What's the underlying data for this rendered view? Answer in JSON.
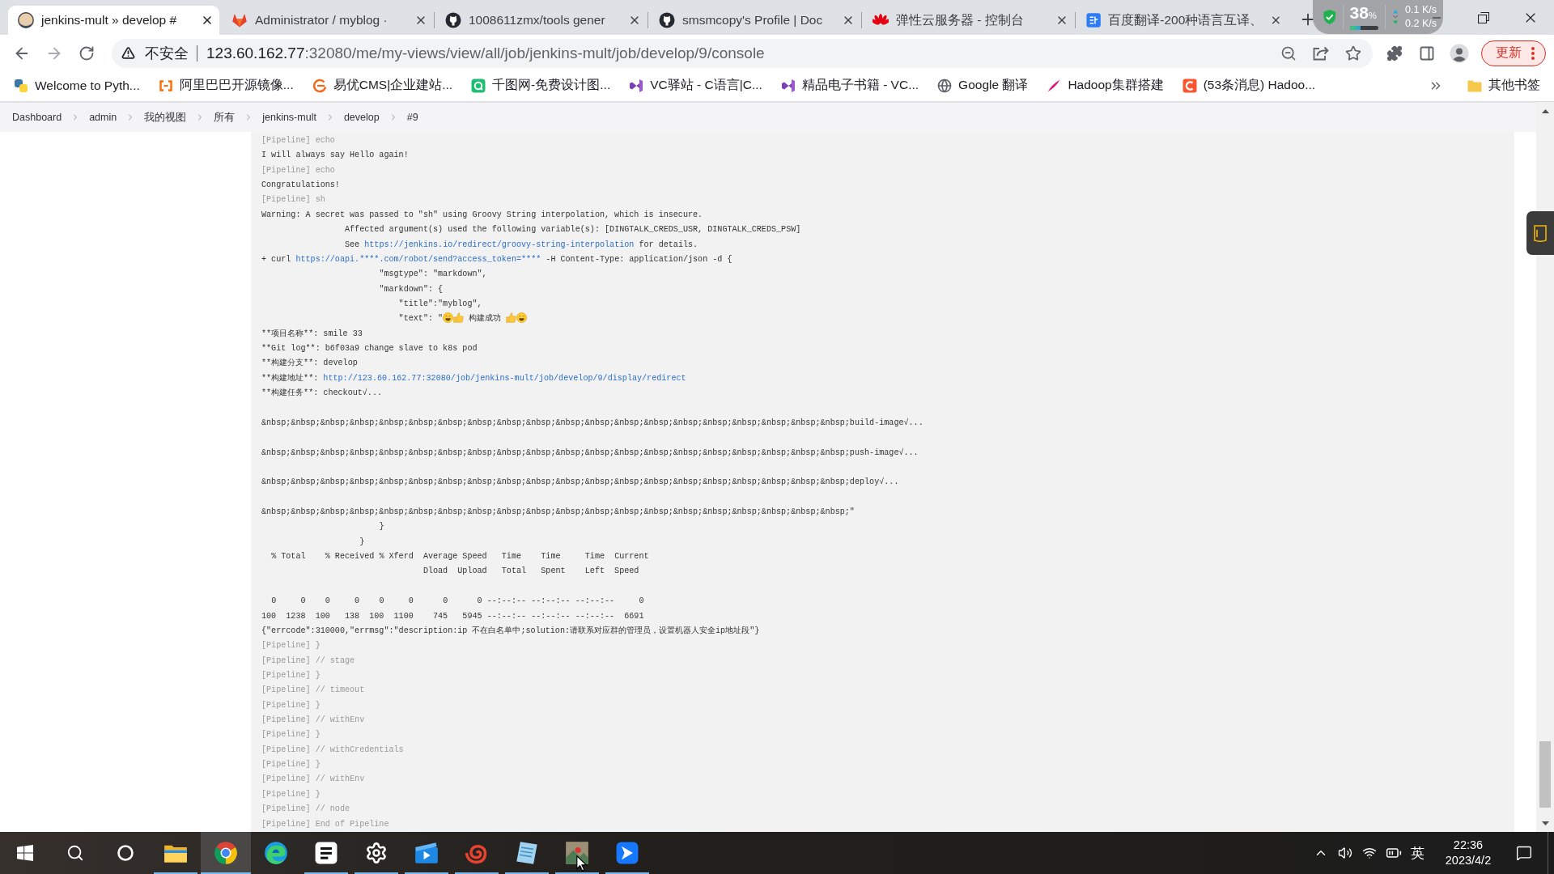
{
  "tabs": [
    {
      "title": "jenkins-mult » develop #",
      "selected": true
    },
    {
      "title": "Administrator / myblog ·",
      "selected": false
    },
    {
      "title": "1008611zmx/tools gener",
      "selected": false
    },
    {
      "title": "smsmcopy's Profile | Doc",
      "selected": false
    },
    {
      "title": "弹性云服务器 - 控制台",
      "selected": false
    },
    {
      "title": "百度翻译-200种语言互译、",
      "selected": false
    }
  ],
  "net_meter": {
    "percent": "38",
    "unit": "%",
    "level": 0.38,
    "upload": "0.1 K/s",
    "download": "0.2 K/s"
  },
  "address_bar": {
    "security": "不安全",
    "host": "123.60.162.77",
    "path": ":32080/me/my-views/view/all/job/jenkins-mult/job/develop/9/console"
  },
  "update_button": "更新",
  "bookmarks": [
    "Welcome to Pyth...",
    "阿里巴巴开源镜像...",
    "易优CMS|企业建站...",
    "千图网-免费设计图...",
    "VC驿站 - C语言|C...",
    "精品电子书籍 - VC...",
    "Google 翻译",
    "Hadoop集群搭建",
    "(53条消息) Hadoo..."
  ],
  "other_bookmarks": "其他书签",
  "breadcrumb": [
    "Dashboard",
    "admin",
    "我的视图",
    "所有",
    "jenkins-mult",
    "develop",
    "#9"
  ],
  "console": {
    "lines": [
      {
        "kind": "step",
        "text": "[Pipeline] echo"
      },
      {
        "kind": "output",
        "text": "I will always say Hello again!"
      },
      {
        "kind": "step",
        "text": "[Pipeline] echo"
      },
      {
        "kind": "output",
        "text": "Congratulations!"
      },
      {
        "kind": "step",
        "text": "[Pipeline] sh"
      },
      {
        "kind": "output",
        "text": "Warning: A secret was passed to \"sh\" using Groovy String interpolation, which is insecure."
      },
      {
        "kind": "output",
        "text": "                 Affected argument(s) used the following variable(s): [DINGTALK_CREDS_USR, DINGTALK_CREDS_PSW]"
      },
      {
        "kind": "link",
        "text": "                 See ",
        "link": "https://jenkins.io/redirect/groovy-string-interpolation",
        "after": " for details."
      },
      {
        "kind": "link",
        "text": "+ curl ",
        "link": "https://oapi.****.com/robot/send?access_token=****",
        "after": " -H Content-Type: application/json -d {"
      },
      {
        "kind": "output",
        "text": "                        \"msgtype\": \"markdown\","
      },
      {
        "kind": "output",
        "text": "                        \"markdown\": {"
      },
      {
        "kind": "output",
        "text": "                            \"title\":\"myblog\","
      },
      {
        "kind": "emoji",
        "text": "                            \"text\": \"",
        "label": "构建成功"
      },
      {
        "kind": "output",
        "text": "**项目名称**: smile 33"
      },
      {
        "kind": "output",
        "text": "**Git log**: b6f03a9 change slave to k8s pod"
      },
      {
        "kind": "output",
        "text": "**构建分支**: develop"
      },
      {
        "kind": "link",
        "text": "**构建地址**: ",
        "link": "http://123.60.162.77:32080/job/jenkins-mult/job/develop/9/display/redirect"
      },
      {
        "kind": "output",
        "text": "**构建任务**: checkout√..."
      },
      {
        "kind": "blank"
      },
      {
        "kind": "output",
        "text": "&nbsp;&nbsp;&nbsp;&nbsp;&nbsp;&nbsp;&nbsp;&nbsp;&nbsp;&nbsp;&nbsp;&nbsp;&nbsp;&nbsp;&nbsp;&nbsp;&nbsp;&nbsp;&nbsp;&nbsp;build-image√..."
      },
      {
        "kind": "blank"
      },
      {
        "kind": "output",
        "text": "&nbsp;&nbsp;&nbsp;&nbsp;&nbsp;&nbsp;&nbsp;&nbsp;&nbsp;&nbsp;&nbsp;&nbsp;&nbsp;&nbsp;&nbsp;&nbsp;&nbsp;&nbsp;&nbsp;&nbsp;push-image√..."
      },
      {
        "kind": "blank"
      },
      {
        "kind": "output",
        "text": "&nbsp;&nbsp;&nbsp;&nbsp;&nbsp;&nbsp;&nbsp;&nbsp;&nbsp;&nbsp;&nbsp;&nbsp;&nbsp;&nbsp;&nbsp;&nbsp;&nbsp;&nbsp;&nbsp;&nbsp;deploy√..."
      },
      {
        "kind": "blank"
      },
      {
        "kind": "output",
        "text": "&nbsp;&nbsp;&nbsp;&nbsp;&nbsp;&nbsp;&nbsp;&nbsp;&nbsp;&nbsp;&nbsp;&nbsp;&nbsp;&nbsp;&nbsp;&nbsp;&nbsp;&nbsp;&nbsp;&nbsp;\""
      },
      {
        "kind": "output",
        "text": "                        }"
      },
      {
        "kind": "output",
        "text": "                    }"
      },
      {
        "kind": "output",
        "text": "  % Total    % Received % Xferd  Average Speed   Time    Time     Time  Current"
      },
      {
        "kind": "output",
        "text": "                                 Dload  Upload   Total   Spent    Left  Speed"
      },
      {
        "kind": "blank"
      },
      {
        "kind": "output",
        "text": "  0     0    0     0    0     0      0      0 --:--:-- --:--:-- --:--:--     0"
      },
      {
        "kind": "output",
        "text": "100  1238  100   138  100  1100    745   5945 --:--:-- --:--:-- --:--:--  6691"
      },
      {
        "kind": "output",
        "text": "{\"errcode\":310000,\"errmsg\":\"description:ip 不在白名单中;solution:请联系对应群的管理员，设置机器人安全ip地址段\"}"
      },
      {
        "kind": "step",
        "text": "[Pipeline] }"
      },
      {
        "kind": "step",
        "text": "[Pipeline] // stage"
      },
      {
        "kind": "step",
        "text": "[Pipeline] }"
      },
      {
        "kind": "step",
        "text": "[Pipeline] // timeout"
      },
      {
        "kind": "step",
        "text": "[Pipeline] }"
      },
      {
        "kind": "step",
        "text": "[Pipeline] // withEnv"
      },
      {
        "kind": "step",
        "text": "[Pipeline] }"
      },
      {
        "kind": "step",
        "text": "[Pipeline] // withCredentials"
      },
      {
        "kind": "step",
        "text": "[Pipeline] }"
      },
      {
        "kind": "step",
        "text": "[Pipeline] // withEnv"
      },
      {
        "kind": "step",
        "text": "[Pipeline] }"
      },
      {
        "kind": "step",
        "text": "[Pipeline] // node"
      },
      {
        "kind": "step",
        "text": "[Pipeline] End of Pipeline"
      }
    ]
  },
  "taskbar": {
    "apps": [
      {
        "running": true,
        "selected": false
      },
      {
        "running": true,
        "selected": true
      },
      {
        "running": false,
        "selected": false
      },
      {
        "running": true,
        "selected": false
      },
      {
        "running": true,
        "selected": false
      },
      {
        "running": true,
        "selected": false
      },
      {
        "running": true,
        "selected": false
      },
      {
        "running": true,
        "selected": false
      },
      {
        "running": true,
        "selected": false
      },
      {
        "running": true,
        "selected": false
      }
    ],
    "input_method": "英",
    "time": "22:36",
    "date": "2023/4/2"
  }
}
